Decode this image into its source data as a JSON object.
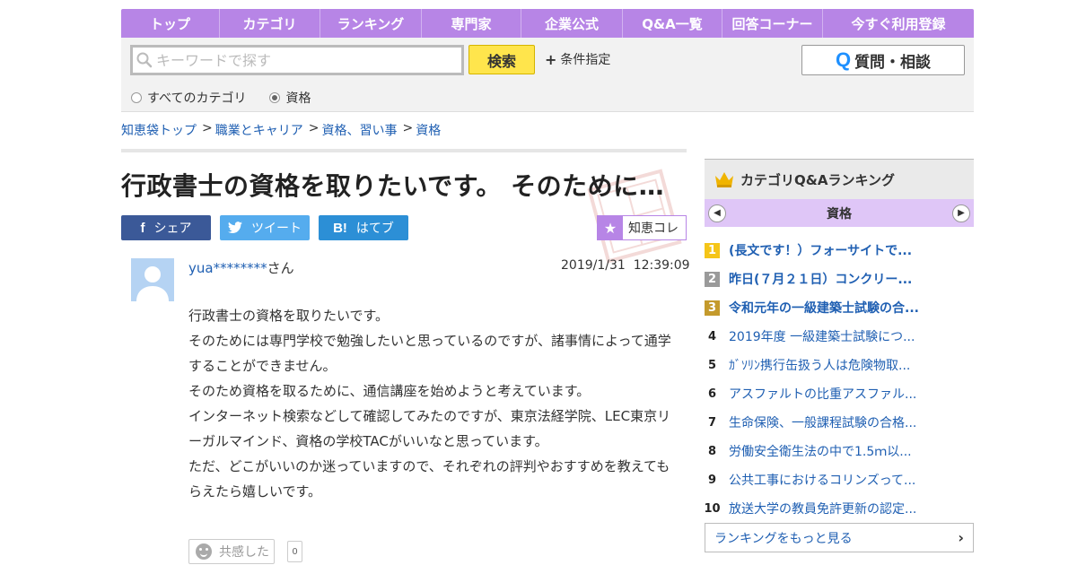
{
  "nav": [
    {
      "label": "トップ"
    },
    {
      "label": "カテゴリ"
    },
    {
      "label": "ランキング"
    },
    {
      "label": "専門家"
    },
    {
      "label": "企業公式"
    },
    {
      "label": "Q&A一覧"
    },
    {
      "label": "回答コーナー"
    },
    {
      "label": "今すぐ利用登録"
    }
  ],
  "search": {
    "placeholder": "キーワードで探す",
    "value": "",
    "button": "検索",
    "condition": "条件指定",
    "ask_button": "質問・相談",
    "radios": [
      {
        "label": "すべてのカテゴリ",
        "selected": false
      },
      {
        "label": "資格",
        "selected": true
      }
    ]
  },
  "breadcrumb": [
    {
      "label": "知恵袋トップ"
    },
    {
      "label": "職業とキャリア"
    },
    {
      "label": "資格、習い事"
    },
    {
      "label": "資格"
    }
  ],
  "question": {
    "title": "行政書士の資格を取りたいです。 そのために…",
    "share": {
      "facebook": "シェア",
      "twitter": "ツイート",
      "hatena": "はてブ"
    },
    "chiekore": "知恵コレ",
    "user_name": "yua********",
    "user_suffix": "さん",
    "date": "2019/1/31",
    "time": "12:39:09",
    "body": [
      "行政書士の資格を取りたいです。",
      "そのためには専門学校で勉強したいと思っているのですが、諸事情によって通学することができません。",
      "そのため資格を取るために、通信講座を始めようと考えています。",
      "インターネット検索などして確認してみたのですが、東京法経学院、LEC東京リーガルマインド、資格の学校TACがいいなと思っています。",
      "ただ、どこがいいのか迷っていますので、それぞれの評判やおすすめを教えてもらえたら嬉しいです。"
    ],
    "empathy_label": "共感した",
    "empathy_count": "0"
  },
  "sidebar": {
    "heading": "カテゴリQ&Aランキング",
    "category": "資格",
    "items": [
      {
        "rank": "1",
        "text": "(長文です！）フォーサイトで..."
      },
      {
        "rank": "2",
        "text": "昨日(７月２１日）コンクリー..."
      },
      {
        "rank": "3",
        "text": "令和元年の一級建築士試験の合..."
      },
      {
        "rank": "4",
        "text": "2019年度 一級建築士試験につ..."
      },
      {
        "rank": "5",
        "text": "ｶﾞｿﾘﾝ携行缶扱う人は危険物取..."
      },
      {
        "rank": "6",
        "text": "アスファルトの比重アスファル..."
      },
      {
        "rank": "7",
        "text": "生命保険、一般課程試験の合格..."
      },
      {
        "rank": "8",
        "text": "労働安全衛生法の中で1.5ｍ以..."
      },
      {
        "rank": "9",
        "text": "公共工事におけるコリンズって..."
      },
      {
        "rank": "10",
        "text": "放送大学の教員免許更新の認定..."
      }
    ],
    "more": "ランキングをもっと見る"
  },
  "colors": {
    "nav": "#b785e6",
    "link": "#1f5fb2",
    "search_button": "#ffe54c",
    "facebook": "#3b5998",
    "twitter": "#55acee",
    "hatena": "#2c8fd6",
    "category_bar": "#dfc6f7"
  }
}
